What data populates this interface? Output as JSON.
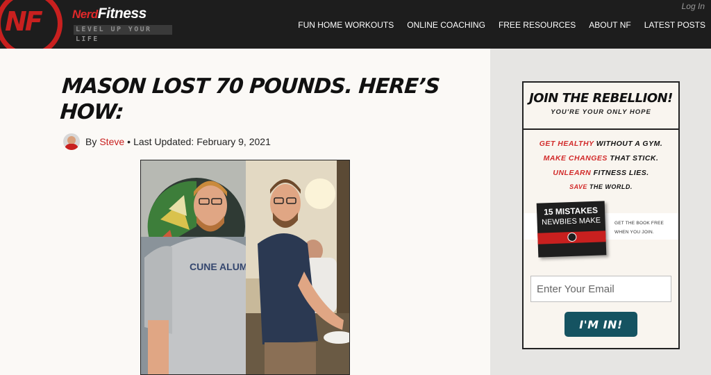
{
  "header": {
    "logo_text": "NF",
    "brand_nerd": "Nerd",
    "brand_fitness": "Fitness",
    "tagline": "LEVEL UP YOUR LIFE",
    "login_label": "Log In",
    "nav": [
      {
        "label": "FUN HOME WORKOUTS"
      },
      {
        "label": "ONLINE COACHING"
      },
      {
        "label": "FREE RESOURCES"
      },
      {
        "label": "ABOUT NF"
      },
      {
        "label": "LATEST POSTS"
      }
    ]
  },
  "article": {
    "title": "Mason Lost 70 Pounds. Here’s How:",
    "by_label": "By",
    "author": "Steve",
    "separator": "•",
    "updated_label": "Last Updated:",
    "updated_date": "February 9, 2021",
    "shirt_text": "CUNE ALUMNI"
  },
  "sidebar": {
    "heading": "JOIN THE REBELLION!",
    "subheading": "YOU'RE YOUR ONLY HOPE",
    "pitch": [
      {
        "red": "GET HEALTHY",
        "rest": " WITHOUT A GYM."
      },
      {
        "red": "MAKE CHANGES",
        "rest": " THAT STICK."
      },
      {
        "red": "UNLEARN",
        "rest": " FITNESS LIES."
      },
      {
        "red": "SAVE",
        "rest": " THE WORLD."
      }
    ],
    "book_title_1": "15 MISTAKES",
    "book_title_2": "NEWBIES MAKE",
    "book_cta_1": "GET THE BOOK FREE",
    "book_cta_2": "WHEN YOU JOIN.",
    "email_placeholder": "Enter Your Email",
    "submit_label": "I'M IN!"
  },
  "colors": {
    "header_bg": "#1d1d1d",
    "brand_red": "#c8201f",
    "sidebar_bg": "#e6e5e3",
    "button_teal": "#155361"
  }
}
